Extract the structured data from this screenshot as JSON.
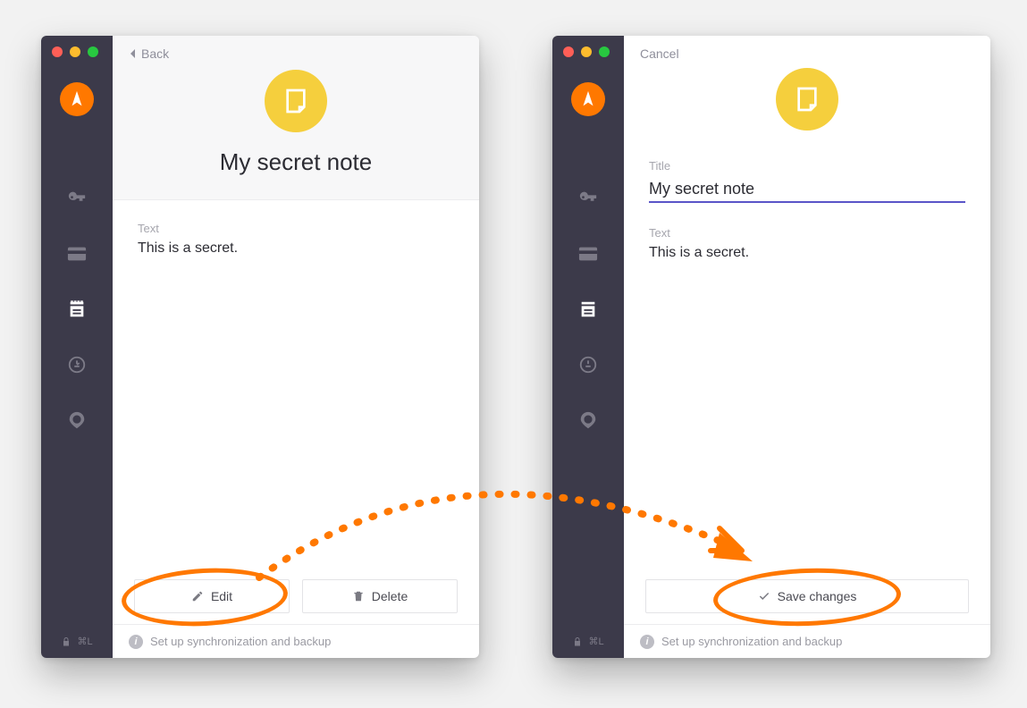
{
  "windowLeft": {
    "backLabel": "Back",
    "title": "My secret note",
    "field": {
      "label": "Text",
      "value": "This is a secret."
    },
    "buttons": {
      "edit": "Edit",
      "delete": "Delete"
    },
    "footer": "Set up synchronization and backup",
    "shortcut": "⌘L"
  },
  "windowRight": {
    "cancelLabel": "Cancel",
    "titleField": {
      "label": "Title",
      "value": "My secret note"
    },
    "textField": {
      "label": "Text",
      "value": "This is a secret."
    },
    "saveLabel": "Save changes",
    "footer": "Set up synchronization and backup",
    "shortcut": "⌘L"
  },
  "colors": {
    "accent": "#ff7800",
    "sidebar": "#3c3a4a",
    "noteBadge": "#f5cf3d",
    "inputUnderline": "#5a55c8"
  }
}
